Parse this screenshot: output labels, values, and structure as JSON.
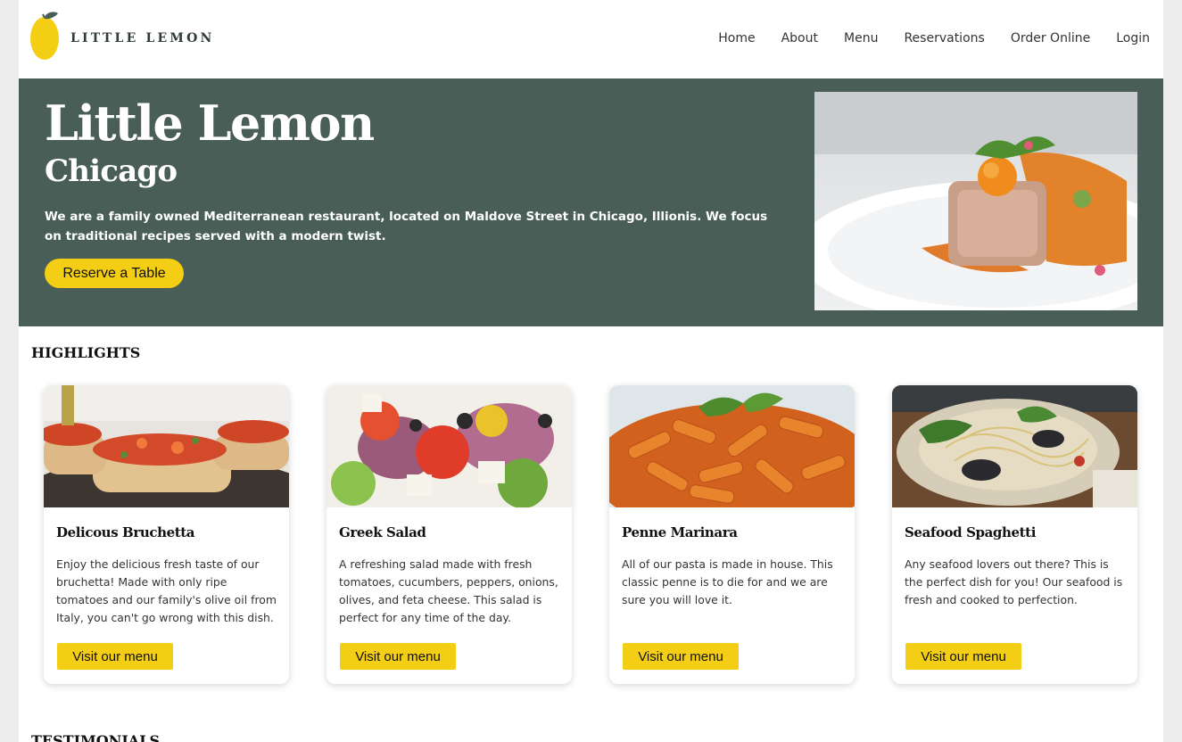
{
  "brand": {
    "name": "LITTLE LEMON"
  },
  "nav": {
    "items": [
      {
        "label": "Home"
      },
      {
        "label": "About"
      },
      {
        "label": "Menu"
      },
      {
        "label": "Reservations"
      },
      {
        "label": "Order Online"
      },
      {
        "label": "Login"
      }
    ]
  },
  "hero": {
    "title": "Little Lemon",
    "subtitle": "Chicago",
    "description": "We are a family owned Mediterranean restaurant, located on Maldove Street in Chicago, Illionis. We focus on traditional recipes served with a modern twist.",
    "cta_label": "Reserve a Table"
  },
  "highlights": {
    "title": "HIGHLIGHTS",
    "cards": [
      {
        "title": "Delicous Bruchetta",
        "description": "Enjoy the delicious fresh taste of our bruchetta! Made with only ripe tomatoes and our family's olive oil from Italy, you can't go wrong with this dish.",
        "button_label": "Visit our menu"
      },
      {
        "title": "Greek Salad",
        "description": "A refreshing salad made with fresh tomatoes, cucumbers, peppers, onions, olives, and feta cheese. This salad is perfect for any time of the day.",
        "button_label": "Visit our menu"
      },
      {
        "title": "Penne Marinara",
        "description": "All of our pasta is made in house. This classic penne is to die for and we are sure you will love it.",
        "button_label": "Visit our menu"
      },
      {
        "title": "Seafood Spaghetti",
        "description": "Any seafood lovers out there? This is the perfect dish for you! Our seafood is fresh and cooked to perfection.",
        "button_label": "Visit our menu"
      }
    ]
  },
  "testimonials": {
    "title": "TESTIMONIALS"
  },
  "colors": {
    "primary_green": "#495e57",
    "accent_yellow": "#f4ce14",
    "page_bg": "#ecedec"
  }
}
